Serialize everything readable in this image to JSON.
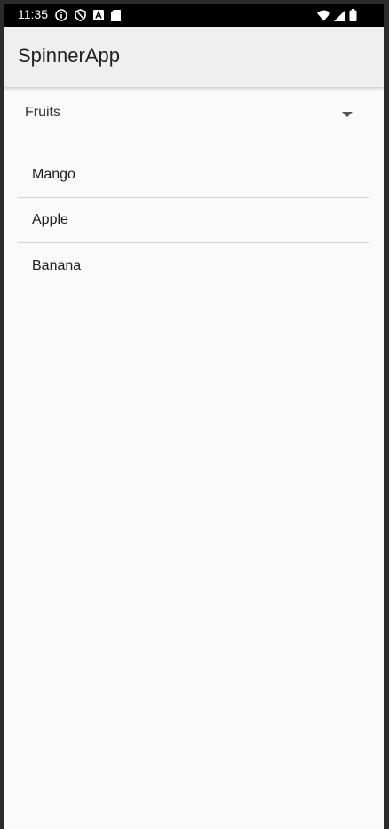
{
  "status_bar": {
    "time": "11:35",
    "left_icons": [
      "info-icon",
      "shield-icon",
      "a-badge-icon",
      "sim-card-icon"
    ],
    "right_icons": [
      "wifi-icon",
      "cell-signal-icon",
      "battery-icon"
    ]
  },
  "app_bar": {
    "title": "SpinnerApp"
  },
  "spinner": {
    "selected": "Fruits",
    "icon": "dropdown-arrow-icon"
  },
  "list": {
    "items": [
      {
        "label": "Mango"
      },
      {
        "label": "Apple"
      },
      {
        "label": "Banana"
      }
    ]
  },
  "colors": {
    "status_bar_bg": "#000000",
    "app_bar_bg": "#efefef",
    "content_bg": "#fafafa",
    "divider": "#d4d4d4"
  }
}
